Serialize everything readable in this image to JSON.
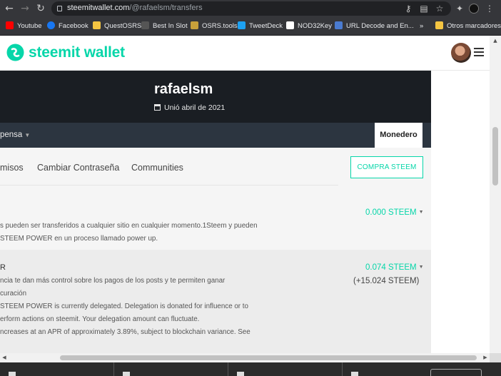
{
  "browser": {
    "url_domain": "steemitwallet.com",
    "url_path": "/@rafaelsm/transfers",
    "bookmarks": [
      {
        "label": "Youtube",
        "color": "#ff0000"
      },
      {
        "label": "Facebook",
        "color": "#1877f2"
      },
      {
        "label": "QuestOSRS",
        "color": "#f5c542"
      },
      {
        "label": "Best In Slot",
        "color": "#555555"
      },
      {
        "label": "OSRS.tools",
        "color": "#c8a03a"
      },
      {
        "label": "TweetDeck",
        "color": "#1da1f2"
      },
      {
        "label": "NOD32Key",
        "color": "#ffffff"
      },
      {
        "label": "URL Decode and En...",
        "color": "#4a7bd0"
      }
    ],
    "more_bookmarks": "»",
    "other_bookmarks": "Otros marcadores"
  },
  "site": {
    "logo_text": "steemit wallet"
  },
  "profile": {
    "username": "rafaelsm",
    "joined": "Unió abril de 2021"
  },
  "subnav": {
    "left_label": "pensa",
    "wallet_tab": "Monedero"
  },
  "wallet_tabs": [
    "misos",
    "Cambiar Contraseña",
    "Communities"
  ],
  "buy_button": "COMPRA STEEM",
  "steem_row": {
    "desc_lines": [
      "s pueden ser transferidos a cualquier sitio en cualquier momento.1Steem y pueden",
      "STEEM POWER en un proceso llamado power up."
    ],
    "amount": "0.000 STEEM"
  },
  "sp_row": {
    "title": "R",
    "desc_lines": [
      "ncia te dan más control sobre los pagos de los posts y te permiten ganar",
      "curación",
      "STEEM POWER is currently delegated. Delegation is donated for influence or to",
      "erform actions on steemit. Your delegation amount can fluctuate.",
      "ncreases at an APR of approximately 3.89%, subject to blockchain variance. See"
    ],
    "amount": "0.074 STEEM",
    "delegated": "(+15.024 STEEM)"
  }
}
